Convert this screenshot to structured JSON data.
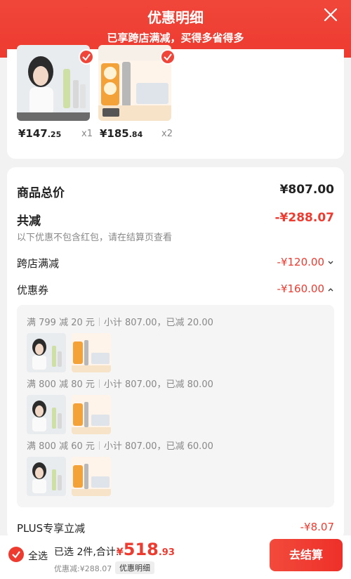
{
  "header": {
    "title": "优惠明细",
    "subtitle": "已享跨店满减，买得多省得多",
    "close_icon": "close-icon"
  },
  "products": [
    {
      "price_main": "¥147",
      "price_cents": ".25",
      "qty": "x1"
    },
    {
      "price_main": "¥185",
      "price_cents": ".84",
      "qty": "x2"
    }
  ],
  "summary": {
    "total_label": "商品总价",
    "total_value": "¥807.00",
    "discount_label": "共减",
    "discount_value": "-¥288.07",
    "discount_note": "以下优惠不包含红包，请在结算页查看",
    "cross_store_label": "跨店满减",
    "cross_store_value": "-¥120.00",
    "coupon_label": "优惠券",
    "coupon_value": "-¥160.00",
    "plus_label": "PLUS专享立减",
    "plus_value": "-¥8.07"
  },
  "coupons": [
    {
      "rule": "满 799 减 20 元",
      "detail": "小计 807.00，已减 20.00"
    },
    {
      "rule": "满 800 减 80 元",
      "detail": "小计 807.00，已减 80.00"
    },
    {
      "rule": "满 800 减 60 元",
      "detail": "小计 807.00，已减 60.00"
    }
  ],
  "bottom": {
    "select_all": "全选",
    "selected_text": "已选 2件,合计:",
    "currency": "¥",
    "amount_main": "518",
    "amount_cents": ".93",
    "saved_text": "优惠减:¥288.07",
    "detail_tag": "优惠明细",
    "checkout": "去结算"
  },
  "colors": {
    "accent": "#ee3b30"
  }
}
